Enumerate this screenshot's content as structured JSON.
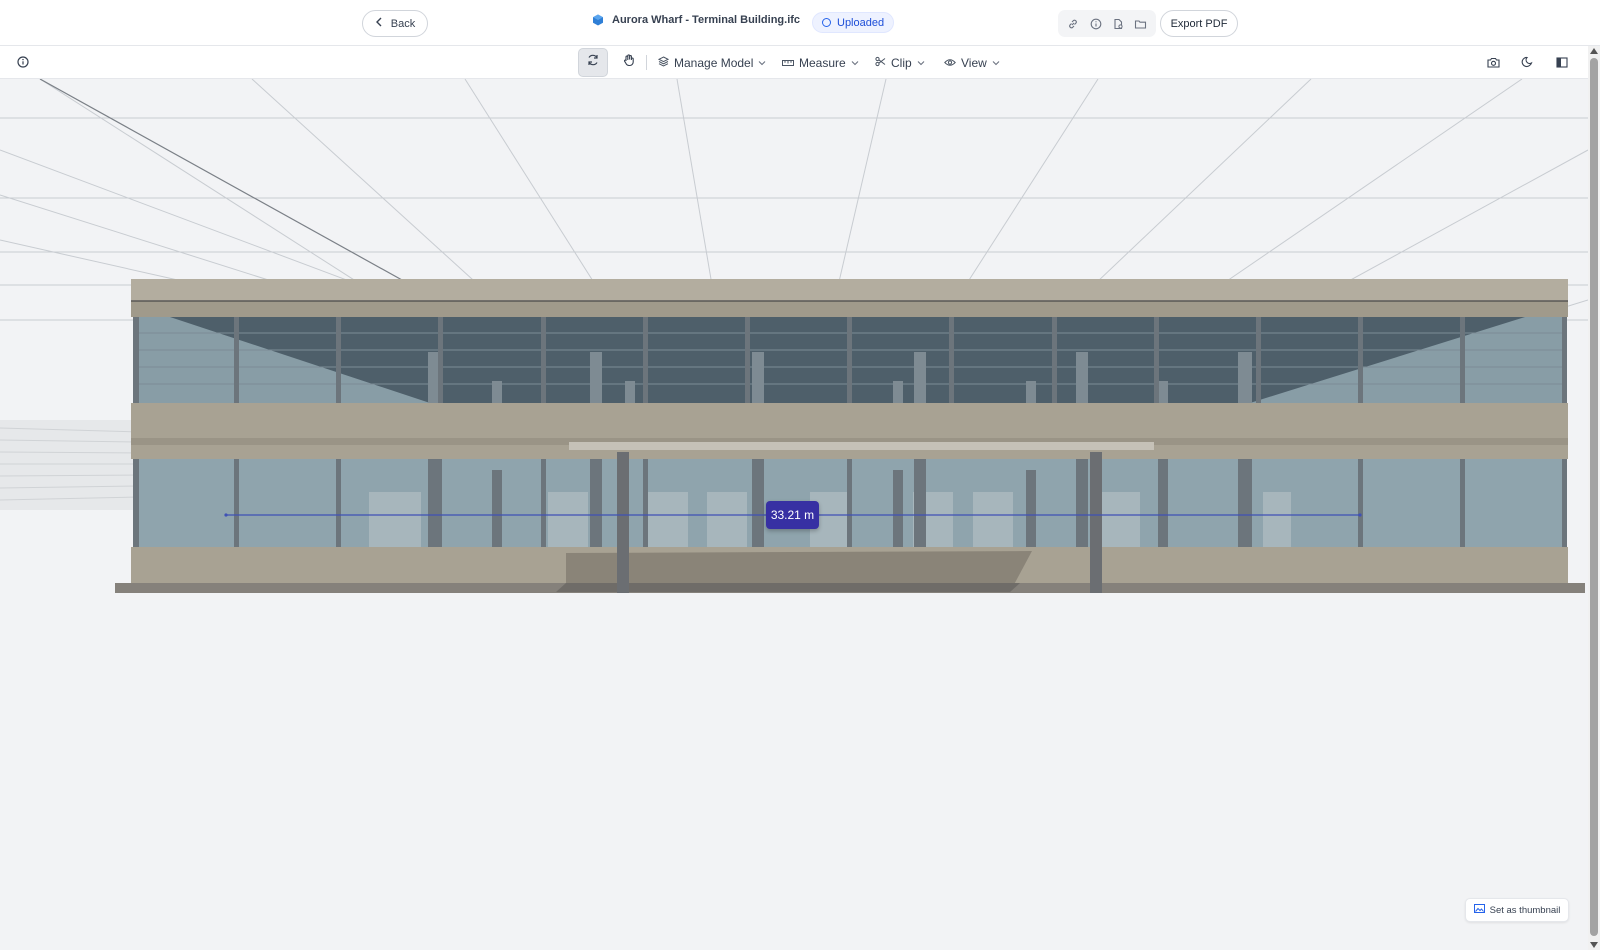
{
  "header": {
    "back_label": "Back",
    "file_title": "Aurora Wharf - Terminal Building.ifc",
    "status": "Uploaded",
    "export_label": "Export PDF",
    "icons": [
      "link-icon",
      "info-icon",
      "file-icon",
      "folder-icon"
    ]
  },
  "toolbar": {
    "manage_model": "Manage Model",
    "measure": "Measure",
    "clip": "Clip",
    "view": "View",
    "right_icons": [
      "camera-icon",
      "moon-icon",
      "panel-icon"
    ]
  },
  "viewer": {
    "measurement": "33.21 m",
    "thumbnail_label": "Set as thumbnail"
  },
  "colors": {
    "accent": "#3730a3",
    "status_blue": "#2563eb",
    "facade": "#a09a8b",
    "glass": "#8fa4ad"
  }
}
